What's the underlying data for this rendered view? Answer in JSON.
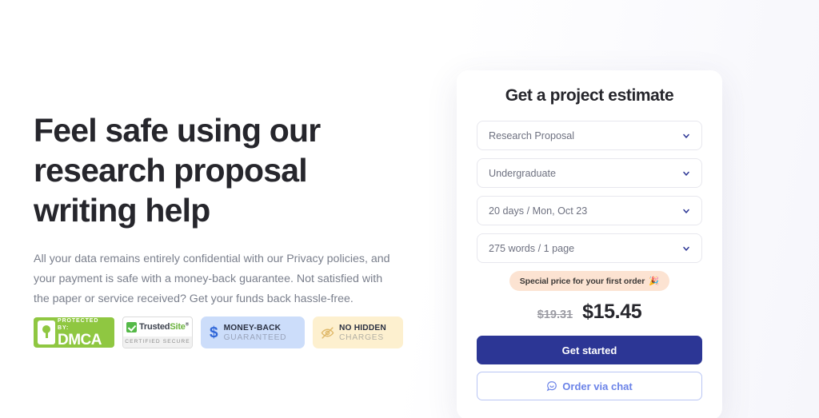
{
  "hero": {
    "headline": "Feel safe using our research proposal writing help",
    "subcopy": "All your data remains entirely confidential with our Privacy policies, and your payment is safe with a money-back guarantee. Not satisfied with the paper or service received? Get your funds back hassle-free."
  },
  "badges": {
    "dmca": {
      "protected_by": "PROTECTED BY:",
      "name": "DMCA",
      "icon": "lock-icon"
    },
    "trustedsite": {
      "name_dark": "Trusted",
      "name_green": "Site",
      "registered": "®",
      "caption": "CERTIFIED SECURE",
      "icon": "check-icon"
    },
    "money_back": {
      "line1": "MONEY-BACK",
      "line2": "GUARANTEED",
      "icon": "dollar-icon"
    },
    "no_hidden": {
      "line1": "NO HIDDEN",
      "line2": "CHARGES",
      "icon": "eye-slash-icon"
    }
  },
  "estimate_card": {
    "title": "Get a project estimate",
    "fields": [
      {
        "name": "paper-type",
        "value": "Research Proposal"
      },
      {
        "name": "academic-level",
        "value": "Undergraduate"
      },
      {
        "name": "deadline",
        "value": "20 days / Mon, Oct 23"
      },
      {
        "name": "word-count",
        "value": "275 words / 1 page"
      }
    ],
    "special_offer": {
      "text": "Special price for your first order",
      "emoji": "🎉"
    },
    "price": {
      "old": "$19.31",
      "new": "$15.45"
    },
    "primary_button": "Get started",
    "secondary_button": "Order via chat",
    "secondary_icon": "chat-bubble-icon",
    "accent_color": "#2c3695",
    "secondary_color": "#6b83e8",
    "badge_color": "#fce3d2"
  }
}
